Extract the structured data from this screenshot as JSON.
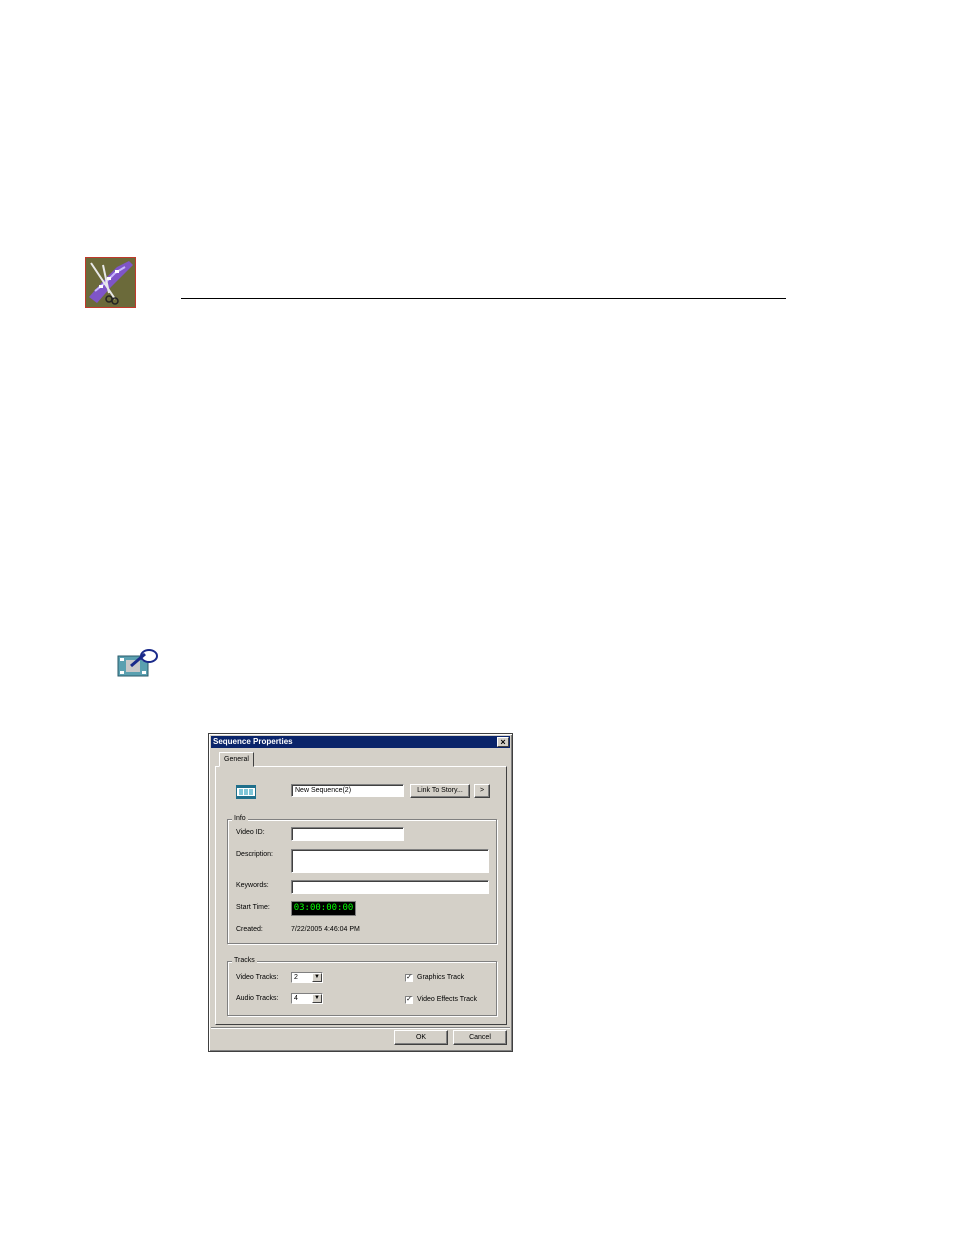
{
  "dialog": {
    "title": "Sequence Properties",
    "close_glyph": "×",
    "tab_label": "General",
    "sequence_name": "New Sequence(2)",
    "link_button": "Link To Story...",
    "more_button": ">",
    "info": {
      "group_title": "Info",
      "video_id_label": "Video ID:",
      "video_id_value": "",
      "description_label": "Description:",
      "description_value": "",
      "keywords_label": "Keywords:",
      "keywords_value": "",
      "start_time_label": "Start Time:",
      "start_time_value": "03:00:00:00",
      "created_label": "Created:",
      "created_value": "7/22/2005 4:46:04 PM"
    },
    "tracks": {
      "group_title": "Tracks",
      "video_tracks_label": "Video Tracks:",
      "video_tracks_value": "2",
      "audio_tracks_label": "Audio Tracks:",
      "audio_tracks_value": "4",
      "graphics_track_label": "Graphics Track",
      "graphics_track_checked": true,
      "video_effects_track_label": "Video Effects Track",
      "video_effects_track_checked": true,
      "check_glyph": "✓",
      "dropdown_glyph": "▼"
    },
    "ok_button": "OK",
    "cancel_button": "Cancel"
  },
  "colors": {
    "title_bar": "#0a246a",
    "dialog_face": "#d4d0c8",
    "timecode_text": "#00ff00"
  },
  "icons": [
    "chapter-logo-icon",
    "note-icon",
    "sequence-film-icon"
  ]
}
